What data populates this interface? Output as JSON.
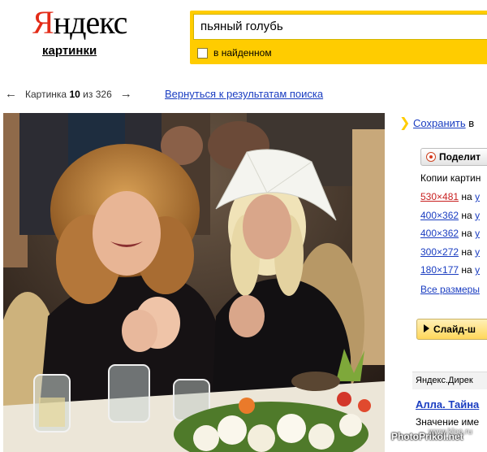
{
  "header": {
    "logo_first": "Я",
    "logo_rest": "ндекс",
    "service": "картинки"
  },
  "search": {
    "query": "пьяный голубь",
    "found_label": "в найденном"
  },
  "nav": {
    "prev_arrow": "←",
    "next_arrow": "→",
    "picture_label": "Картинка",
    "current": "10",
    "of_label": "из",
    "total": "326",
    "back_to_results": "Вернуться к результатам поиска"
  },
  "sidebar": {
    "save_chevron": "❯",
    "save_link": "Сохранить",
    "save_rest": "в",
    "share_label": "Поделит",
    "copies_title": "Копии картин",
    "copies": [
      {
        "size": "530×481",
        "on": "на",
        "site": "у"
      },
      {
        "size": "400×362",
        "on": "на",
        "site": "у"
      },
      {
        "size": "400×362",
        "on": "на",
        "site": "у"
      },
      {
        "size": "300×272",
        "on": "на",
        "site": "у"
      },
      {
        "size": "180×177",
        "on": "на",
        "site": "у"
      }
    ],
    "all_sizes": "Все размеры",
    "slideshow": "Слайд-ш",
    "direct_title": "Яндекс.Дирек",
    "ad_title": "Алла. Тайна",
    "ad_text": "Значение име"
  },
  "photo": {
    "watermark_main": "PhotoPrikol.net",
    "watermark_small": "www.kloo.ru"
  },
  "colors": {
    "accent_yellow": "#ffcc00",
    "logo_red": "#e32b17",
    "link_blue": "#1a3dc1",
    "visited_red": "#c82020"
  }
}
